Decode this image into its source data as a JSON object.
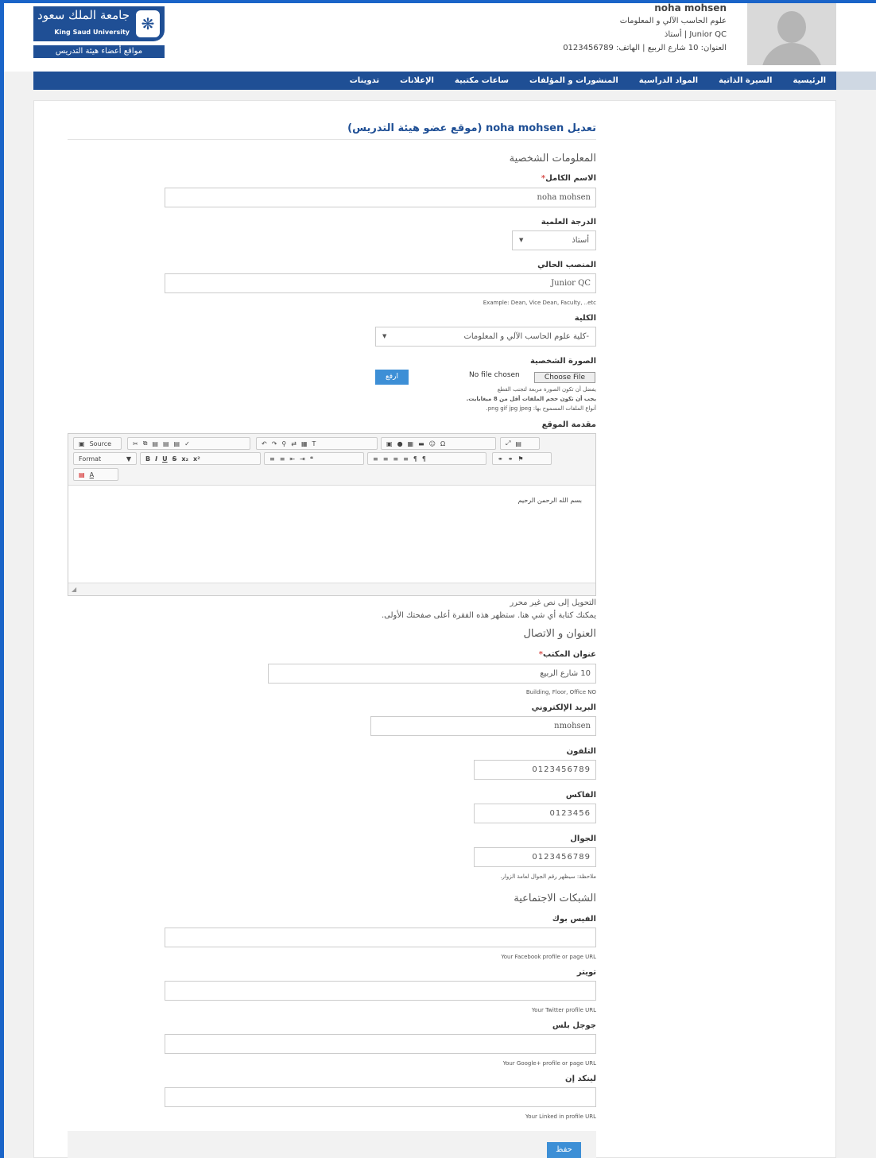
{
  "header": {
    "logo": {
      "arabic": "جامعة الملك سعود",
      "english": "King Saud University",
      "site_name": "مواقع أعضاء هيئة التدريس"
    },
    "profile": {
      "name": "noha mohsen",
      "department": "علوم الحاسب الآلي و المعلومات",
      "title_line": "Junior QC | أستاذ",
      "address_line": "العنوان: 10 شارع الربيع | الهاتف: 0123456789"
    }
  },
  "nav": {
    "items": [
      "الرئيسية",
      "السيرة الذاتية",
      "المواد الدراسية",
      "المنشورات و المؤلفات",
      "ساعات مكتبية",
      "الإعلانات",
      "تدوينات"
    ]
  },
  "form": {
    "title": "تعديل noha mohsen (موقع عضو هيئة التدريس)",
    "personal": {
      "heading": "المعلومات الشخصية",
      "full_name_label": "الاسم الكامل",
      "full_name_value": "noha mohsen",
      "degree_label": "الدرجة العلمية",
      "degree_value": "أستاذ",
      "position_label": "المنصب الحالي",
      "position_value": "Junior QC",
      "position_help": "Example: Dean, Vice Dean, Faculty, ..etc",
      "college_label": "الكلية",
      "college_value": "-كلية علوم الحاسب الآلي و المعلومات",
      "photo_label": "الصورة الشخصية",
      "choose_file": "Choose File",
      "no_file": "No file chosen",
      "upload_button": "ارفع",
      "photo_help_1": "يفضل أن تكون الصورة مربعة لتجنب القطع",
      "photo_help_2": "يجب أن تكون حجم الملفات أقل من 8 ميغابايت.",
      "photo_help_3": "أنواع الملفات المسموح بها: png gif jpg jpeg.",
      "intro_label": "مقدمة الموقع",
      "editor_source": "Source",
      "editor_format": "Format",
      "editor_content": "بسم الله الرحمن الرحيم",
      "editor_plain": "التحويل إلى نص غير محرر",
      "editor_help": "يمكنك كتابة أي شي هنا. ستظهر هذه الفقرة أعلى صفحتك الأولى."
    },
    "contact": {
      "heading": "العنوان و الاتصال",
      "office_label": "عنوان المكتب",
      "office_value": "10 شارع الربيع",
      "office_help": "Building, Floor, Office NO",
      "email_label": "البريد الإلكتروني",
      "email_value": "nmohsen",
      "phone_label": "التلفون",
      "phone_value": "0123456789",
      "fax_label": "الفاكس",
      "fax_value": "0123456",
      "mobile_label": "الجوال",
      "mobile_value": "0123456789",
      "mobile_help": "ملاحظة: سيظهر رقم الجوال لعامة الزوار."
    },
    "social": {
      "heading": "الشبكات الاجتماعية",
      "facebook_label": "الفيس بوك",
      "facebook_help": "Your Facebook profile or page URL",
      "twitter_label": "تويتر",
      "twitter_help": "Your Twitter profile URL",
      "google_label": "جوجل بلس",
      "google_help": "Your Google+ profile or page URL",
      "linkedin_label": "لينكد إن",
      "linkedin_help": "Your Linked in profile URL"
    },
    "save_button": "حفظ"
  }
}
